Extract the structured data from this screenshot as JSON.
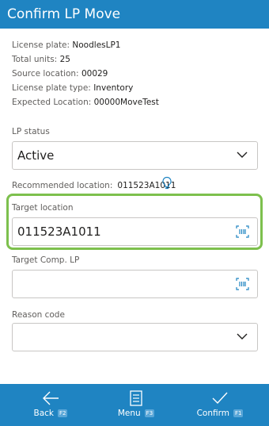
{
  "header": {
    "title": "Confirm LP Move"
  },
  "info": [
    {
      "label": "License plate:",
      "value": "NoodlesLP1"
    },
    {
      "label": "Total units:",
      "value": "25"
    },
    {
      "label": "Source location:",
      "value": "00029"
    },
    {
      "label": "License plate type:",
      "value": "Inventory"
    },
    {
      "label": "Expected Location:",
      "value": "00000MoveTest"
    }
  ],
  "lp_status": {
    "label": "LP status",
    "value": "Active"
  },
  "recommended": {
    "label": "Recommended location:",
    "value": "011523A1011"
  },
  "target_location": {
    "label": "Target location",
    "value": "011523A1011"
  },
  "target_comp_lp": {
    "label": "Target Comp. LP",
    "value": ""
  },
  "reason_code": {
    "label": "Reason code",
    "value": ""
  },
  "footer": {
    "back": {
      "label": "Back",
      "key": "F2"
    },
    "menu": {
      "label": "Menu",
      "key": "F3"
    },
    "confirm": {
      "label": "Confirm",
      "key": "F1"
    }
  },
  "colors": {
    "brand": "#1f84c2",
    "focus_highlight": "#7dc04d",
    "icon_blue": "#1f84c2"
  }
}
